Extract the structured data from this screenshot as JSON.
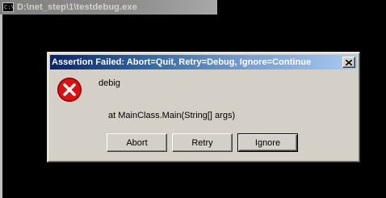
{
  "console": {
    "title": "D:\\net_step\\1\\testdebug.exe",
    "icon": "console-icon",
    "icon_text": "C:\\"
  },
  "dialog": {
    "title": "Assertion Failed: Abort=Quit, Retry=Debug, Ignore=Continue",
    "icon": "error-icon",
    "message_line_1": "debig",
    "message_line_2": "at MainClass.Main(String[] args)",
    "buttons": {
      "abort": "Abort",
      "retry": "Retry",
      "ignore": "Ignore"
    },
    "close_icon": "close-icon"
  },
  "colors": {
    "console_background": "#000000",
    "dialog_background": "#d4d0c8",
    "dialog_title_start": "#0a246a",
    "dialog_title_end": "#a6caf0",
    "error_red": "#e01010"
  }
}
